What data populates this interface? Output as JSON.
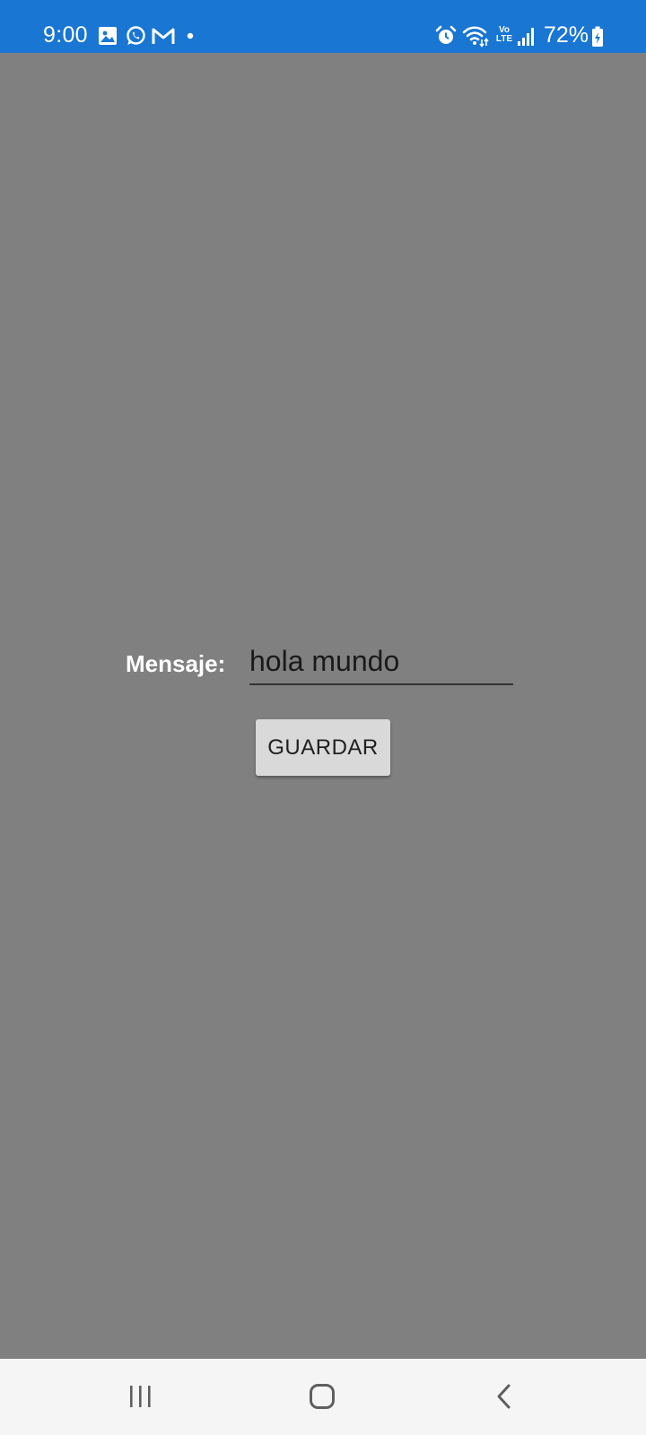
{
  "status_bar": {
    "time": "9:00",
    "battery": "72%",
    "color": "#1976d2",
    "left_icons": [
      "gallery-icon",
      "whatsapp-icon",
      "gmail-icon",
      "notification-dot-icon"
    ],
    "right_icons": [
      "alarm-icon",
      "wifi-icon",
      "volte-icon",
      "signal-icon",
      "battery-charging-icon"
    ],
    "volte_text": "Vo LTE"
  },
  "form": {
    "label": "Mensaje:",
    "input_value": "hola mundo",
    "button_label": "GUARDAR"
  },
  "background_color": "#808080",
  "nav_bar": {
    "buttons": [
      "recent-apps-icon",
      "home-icon",
      "back-icon"
    ]
  }
}
